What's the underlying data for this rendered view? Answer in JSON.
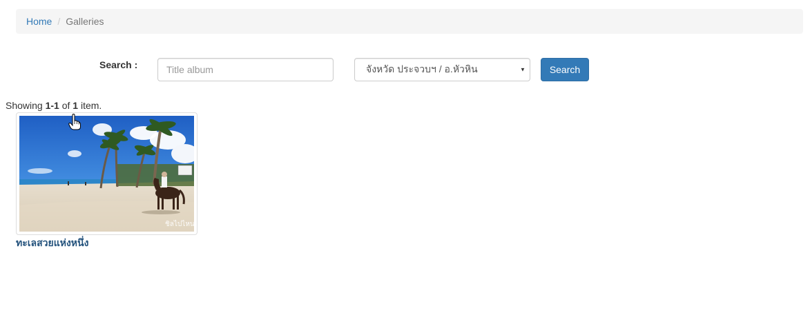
{
  "breadcrumb": {
    "home": "Home",
    "separator": "/",
    "current": "Galleries"
  },
  "search": {
    "label": "Search :",
    "placeholder": "Title album",
    "value": "",
    "province_selected": "จังหวัด ประจวบฯ / อ.หัวหิน",
    "button": "Search"
  },
  "summary": {
    "prefix": "Showing ",
    "range": "1-1",
    "middle": " of ",
    "total": "1",
    "suffix": " item."
  },
  "albums": [
    {
      "title": "ทะเลสวยแห่งหนึ่ง",
      "image_watermark": "ชิลไปไหน"
    }
  ],
  "colors": {
    "link": "#337ab7",
    "button": "#337ab7",
    "album_title": "#23527c",
    "breadcrumb_bg": "#f5f5f5"
  },
  "icons": {
    "select_caret": "caret-down-icon",
    "pointer": "hand-pointer-icon"
  }
}
